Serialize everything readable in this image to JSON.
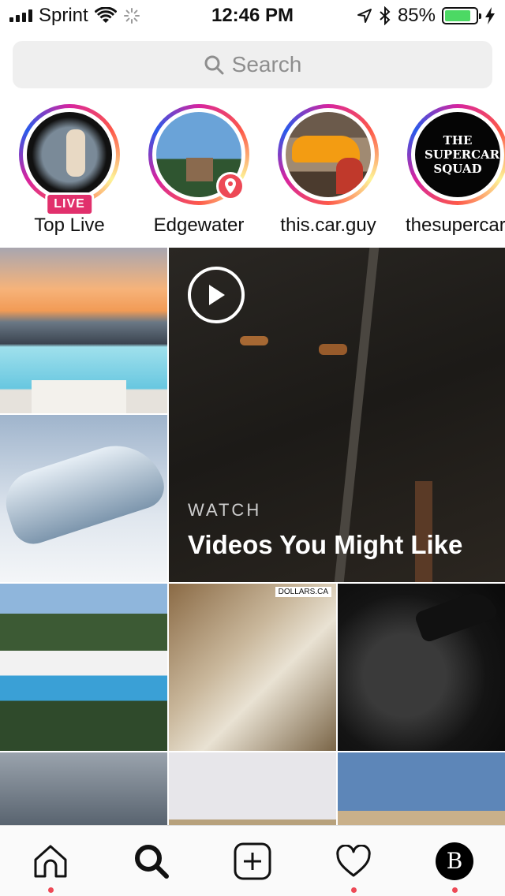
{
  "status": {
    "carrier": "Sprint",
    "time": "12:46 PM",
    "battery": "85%",
    "battery_level": 0.85
  },
  "search": {
    "placeholder": "Search"
  },
  "stories": [
    {
      "label": "Top Live",
      "badge": "LIVE"
    },
    {
      "label": "Edgewater"
    },
    {
      "label": "this.car.guy"
    },
    {
      "label": "thesupercar.",
      "logo_text": "THE SUPERCAR SQUAD"
    }
  ],
  "featured": {
    "overline": "WATCH",
    "title": "Videos You Might Like"
  },
  "grid_tiles": [
    {
      "desc": "sunset-pool"
    },
    {
      "desc": "flying-yacht"
    },
    {
      "desc": "modern-villa"
    },
    {
      "desc": "box-of-cash",
      "watermark": "DOLLARS.CA"
    },
    {
      "desc": "dragon-sneaker"
    },
    {
      "desc": "interior"
    },
    {
      "desc": "red-car"
    },
    {
      "desc": "building"
    }
  ],
  "tabs": [
    {
      "name": "home",
      "icon": "home-icon",
      "dot": true
    },
    {
      "name": "search",
      "icon": "search-icon",
      "dot": false
    },
    {
      "name": "add",
      "icon": "plus-square-icon",
      "dot": false
    },
    {
      "name": "activity",
      "icon": "heart-icon",
      "dot": true
    },
    {
      "name": "profile",
      "icon": "avatar-icon",
      "dot": true,
      "avatar_letter": "B"
    }
  ],
  "colors": {
    "accent": "#ed4956",
    "live": "#e1306c",
    "battery": "#4cd964"
  }
}
